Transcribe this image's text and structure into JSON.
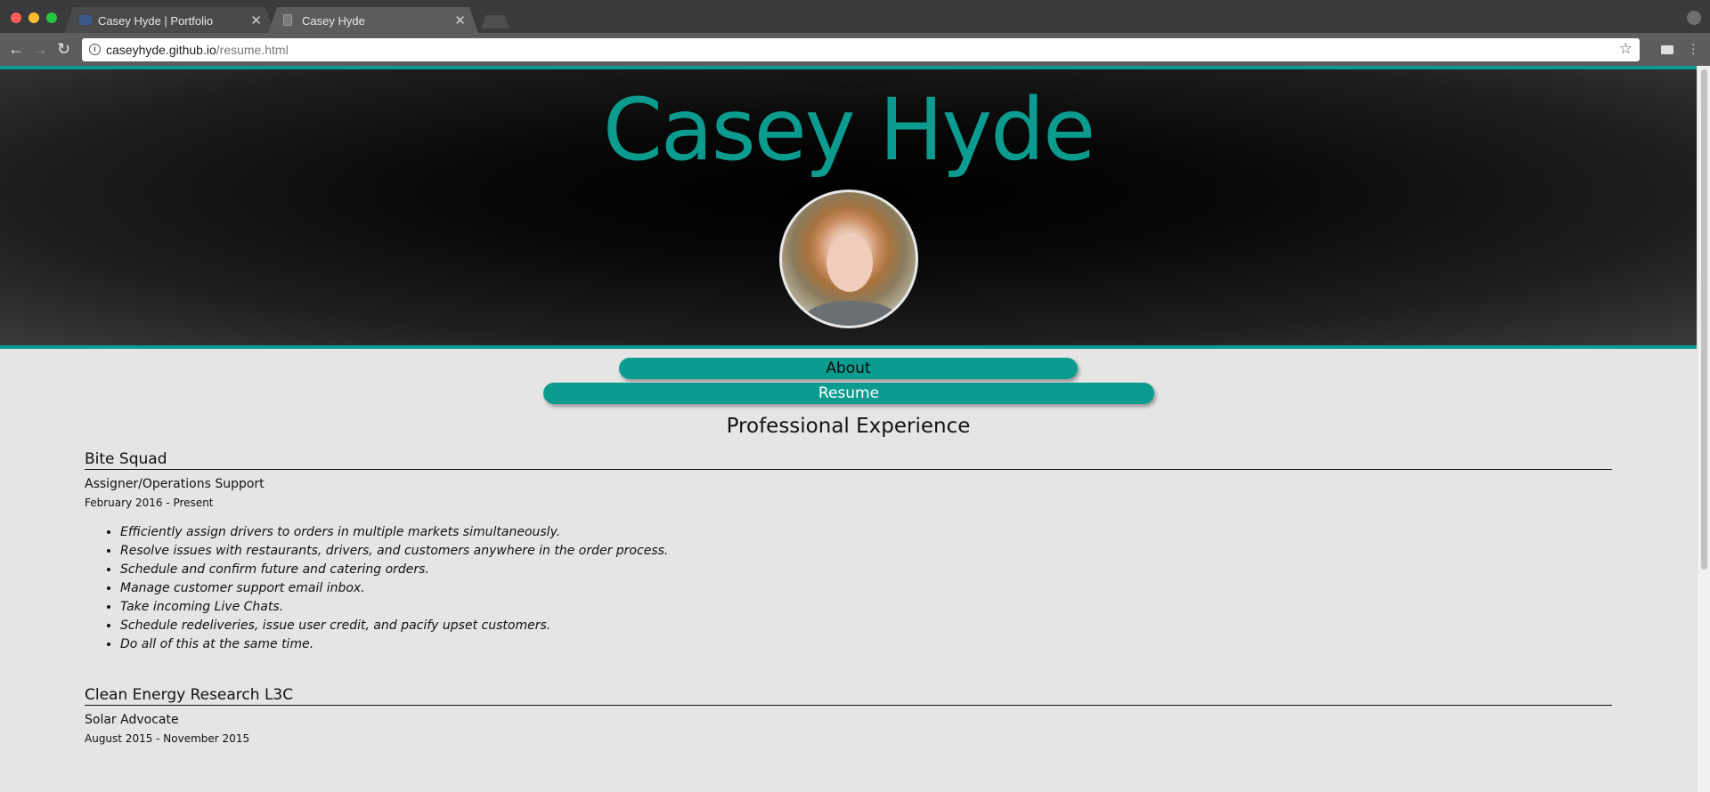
{
  "browser": {
    "tabs": [
      {
        "label": "Casey Hyde | Portfolio",
        "active": false
      },
      {
        "label": "Casey Hyde",
        "active": true
      }
    ],
    "url_host": "caseyhyde.github.io",
    "url_path": "/resume.html"
  },
  "header": {
    "name": "Casey Hyde"
  },
  "nav": {
    "about_label": "About",
    "resume_label": "Resume"
  },
  "section": {
    "title": "Professional Experience"
  },
  "jobs": [
    {
      "company": "Bite Squad",
      "role": "Assigner/Operations Support",
      "dates": "February 2016 - Present",
      "bullets": [
        "Efficiently assign drivers to orders in multiple markets simultaneously.",
        "Resolve issues with restaurants, drivers, and customers anywhere in the order process.",
        "Schedule and confirm future and catering orders.",
        "Manage customer support email inbox.",
        "Take incoming Live Chats.",
        "Schedule redeliveries, issue user credit, and pacify upset customers.",
        "Do all of this at the same time."
      ]
    },
    {
      "company": "Clean Energy Research L3C",
      "role": "Solar Advocate",
      "dates": "August 2015 - November 2015"
    }
  ],
  "colors": {
    "accent": "#0b9b8f",
    "page_bg": "#e5e5e5"
  },
  "icons": [
    "back-icon",
    "forward-icon",
    "reload-icon",
    "info-icon",
    "star-icon",
    "close-icon",
    "profile-icon",
    "menu-icon"
  ]
}
